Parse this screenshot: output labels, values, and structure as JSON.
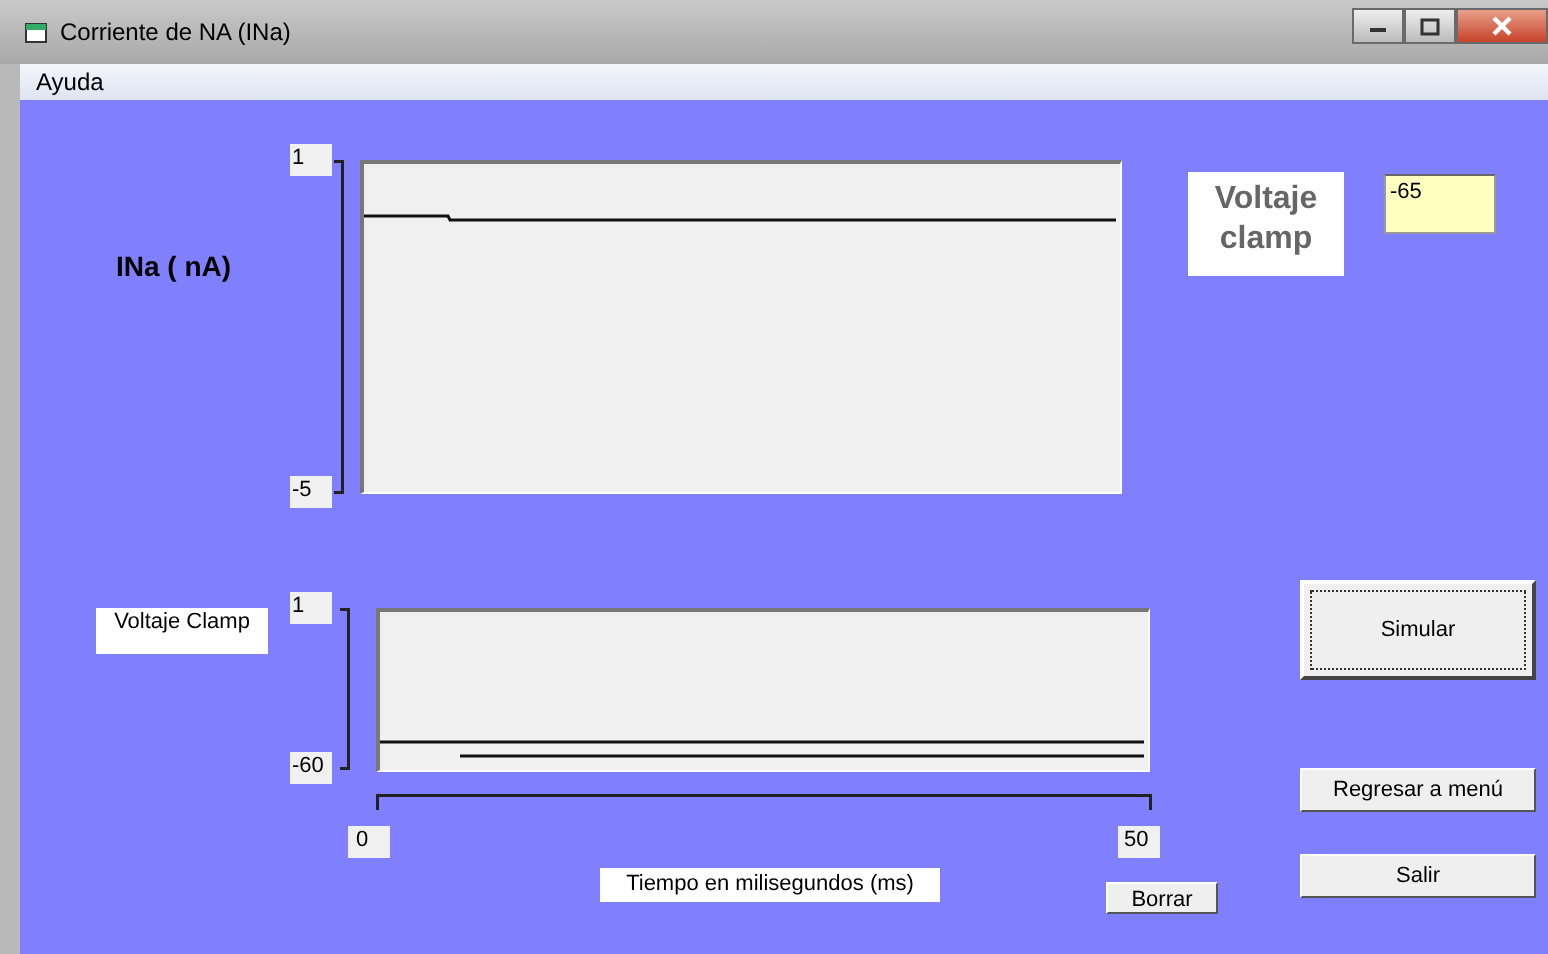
{
  "window": {
    "title": "Corriente de NA (INa)"
  },
  "menu": [
    {
      "label": "Ayuda"
    }
  ],
  "current_plot": {
    "ylabel": "INa ( nA)",
    "y_max": "1",
    "y_min": "-5"
  },
  "voltage_panel": {
    "title": "Voltaje clamp",
    "value": "-65"
  },
  "voltage_plot": {
    "label": "Voltaje Clamp",
    "y_max": "1",
    "y_min": "-60",
    "x_min": "0",
    "x_max": "50",
    "xlabel": "Tiempo en milisegundos (ms)"
  },
  "buttons": [
    {
      "label": "Simular",
      "focused": true
    },
    {
      "label": "Regresar a menú",
      "focused": false
    },
    {
      "label": "Salir",
      "focused": false
    },
    {
      "label": "Borrar",
      "focused": false
    }
  ]
}
